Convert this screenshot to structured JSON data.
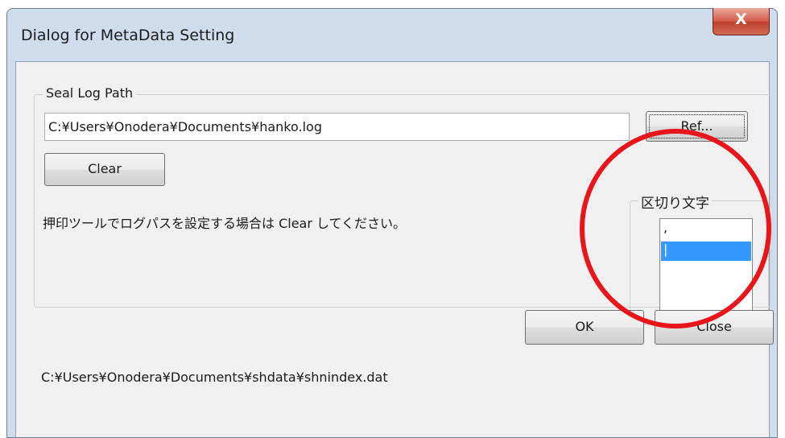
{
  "window": {
    "title": "Dialog for MetaData Setting",
    "close_glyph": "X"
  },
  "seal_log": {
    "group_label": "Seal Log Path",
    "path_value": "C:¥Users¥Onodera¥Documents¥hanko.log",
    "ref_button": "Ref...",
    "clear_button": "Clear",
    "info_text": "押印ツールでログパスを設定する場合は Clear してください。"
  },
  "delimiter": {
    "group_label": "区切り文字",
    "items": [
      ",",
      "|"
    ],
    "selected_index": 1
  },
  "buttons": {
    "ok": "OK",
    "close": "Close"
  },
  "status_path": "C:¥Users¥Onodera¥Documents¥shdata¥shnindex.dat",
  "colors": {
    "selection": "#3399ff",
    "annotation_circle": "#e8161b",
    "close_button": "#c7503e"
  },
  "icons": {
    "window_close": "close-icon"
  }
}
